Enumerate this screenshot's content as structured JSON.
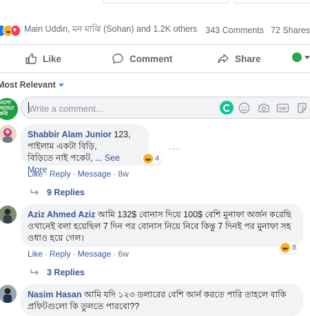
{
  "reactions_bar": {
    "emoji": [
      "like-icon",
      "haha-icon",
      "love-icon"
    ],
    "names": "Main Uddin, মন মাঝি (Sohan) and 1.2K others",
    "comments": "343 Comments",
    "shares": "72 Shares"
  },
  "actions": {
    "like": "Like",
    "comment": "Comment",
    "share": "Share"
  },
  "sort": {
    "label": "Most Relevant"
  },
  "composer": {
    "avatar_text": "এসো আড্ডা করি",
    "placeholder": "Write a comment...",
    "icons": [
      "grammarly-icon",
      "emoji-icon",
      "camera-icon",
      "gif-icon",
      "sticker-icon"
    ]
  },
  "comments": [
    {
      "author": "Shabbir Alam Junior",
      "text_line1": " 123,",
      "text_line2": "পাইলাম একটা বিড়ি,",
      "text_line3": "বিড়িতে নাই পকেট, ...",
      "see_more": "See More",
      "reaction_count": "4",
      "like": "Like",
      "reply": "Reply",
      "message": "Message",
      "time": "8w",
      "replies": "9 Replies"
    },
    {
      "author": "Aziz Ahmed Aziz",
      "text_line1": " আমি 132$ বোনাস দিয়ে 100$ বেশি মুনাফা অর্জন করেছি",
      "text_line2": "ওখানেই বলা হয়েছিল 7 দিন পর বোনাস নিয়ে নিবে কিন্তু 7 দিনই পর মুনাফা সহ",
      "text_line3": "ওধাও হয়ে গেল।",
      "reaction_count": "8",
      "like": "Like",
      "reply": "Reply",
      "message": "Message",
      "time": "6w",
      "replies": "3 Replies"
    },
    {
      "author": "Nasim Hasan",
      "text_line1": " আমি যদি ১২৩ ডলারের বেশি আর্ন করতে পারি তাহলে বাকি",
      "text_line2": "প্রফিটগুলো কি তুলতে পারবো??"
    }
  ],
  "colors": {
    "link": "#385898",
    "muted": "#606770",
    "bubble": "#f2f3f5",
    "fb_blue": "#1877f2"
  }
}
